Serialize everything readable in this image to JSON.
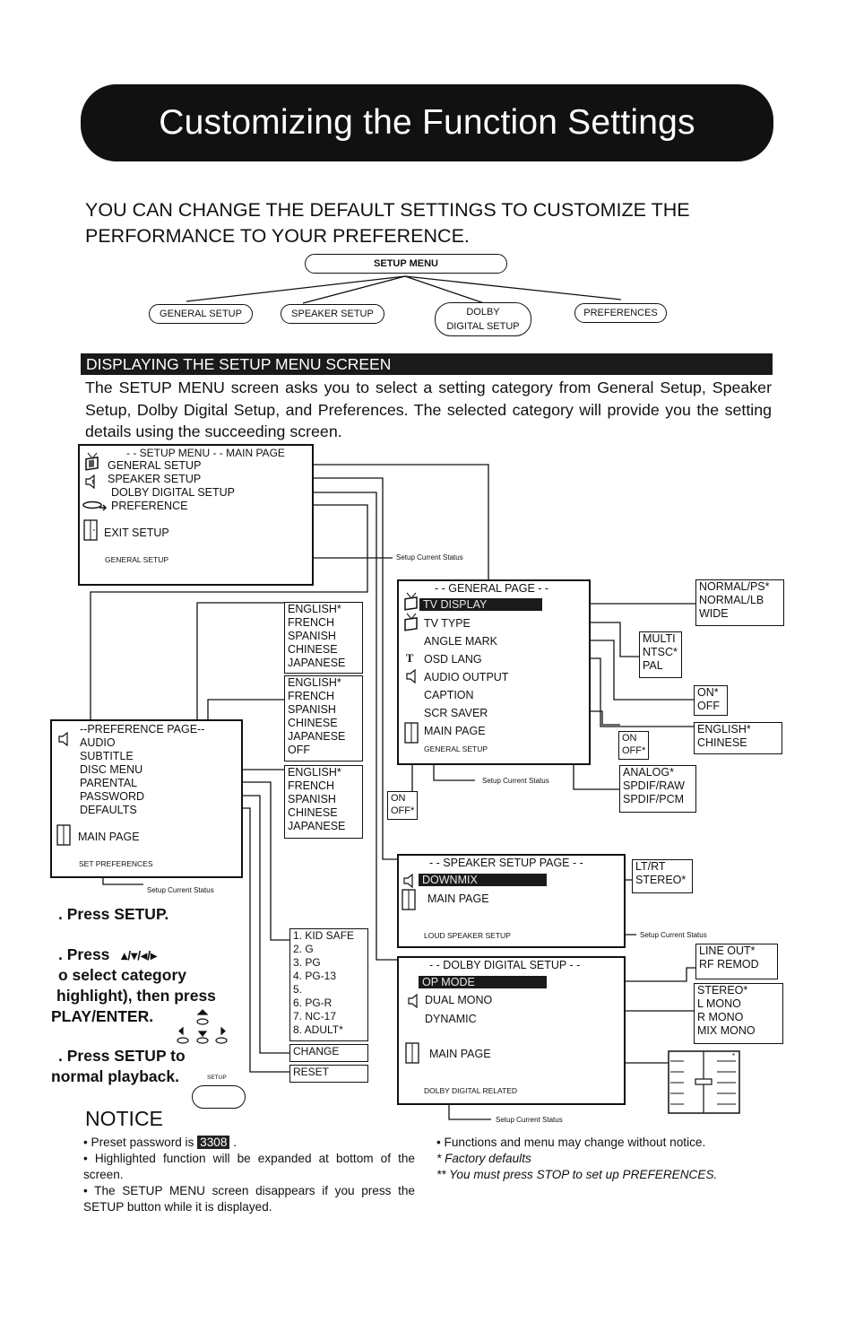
{
  "title": "Customizing the Function Settings",
  "intro": "YOU CAN CHANGE THE DEFAULT SETTINGS TO CUSTOMIZE THE PERFORMANCE TO YOUR PREFERENCE.",
  "tree": {
    "root": "SETUP MENU",
    "children": [
      "GENERAL SETUP",
      "SPEAKER SETUP",
      "DOLBY DIGITAL SETUP",
      "PREFERENCES"
    ],
    "dolby_line1": "DOLBY",
    "dolby_line2": "DIGITAL SETUP"
  },
  "section": {
    "heading": "DISPLAYING THE SETUP MENU SCREEN",
    "paragraph": "The SETUP MENU screen asks you to select a setting category from General Setup, Speaker Setup, Dolby Digital Setup, and Preferences.  The selected category will provide you the setting details using the succeeding screen."
  },
  "main_menu": {
    "title": "- - SETUP MENU - -  MAIN PAGE",
    "items": [
      "GENERAL SETUP",
      "SPEAKER SETUP",
      "DOLBY DIGITAL SETUP",
      "PREFERENCE"
    ],
    "exit": "EXIT SETUP",
    "status": "GENERAL SETUP",
    "status_label": "Setup Current Status"
  },
  "general_page": {
    "title": "- - GENERAL PAGE - -",
    "items": [
      "TV DISPLAY",
      "TV TYPE",
      "ANGLE MARK",
      "OSD LANG",
      "AUDIO OUTPUT",
      "CAPTION",
      "SCR SAVER"
    ],
    "highlighted": "TV DISPLAY",
    "main_page": "MAIN PAGE",
    "status": "GENERAL SETUP",
    "status_label": "Setup Current Status",
    "options": {
      "tv_display": [
        "NORMAL/PS*",
        "NORMAL/LB",
        "WIDE"
      ],
      "tv_type": [
        "MULTI",
        "NTSC*",
        "PAL"
      ],
      "angle_mark": [
        "ON*",
        "OFF"
      ],
      "osd_lang": [
        "ENGLISH*",
        "CHINESE"
      ],
      "scr_saver": [
        "ON",
        "OFF*"
      ],
      "audio_output": [
        "ANALOG*",
        "SPDIF/RAW",
        "SPDIF/PCM"
      ],
      "caption": [
        "ON",
        "OFF*"
      ]
    }
  },
  "preference_page": {
    "title": "--PREFERENCE PAGE--",
    "items": [
      "AUDIO",
      "SUBTITLE",
      "DISC MENU",
      "PARENTAL",
      "PASSWORD",
      "DEFAULTS"
    ],
    "main_page": "MAIN PAGE",
    "status": "SET PREFERENCES",
    "status_label": "Setup Current Status",
    "options": {
      "audio": [
        "ENGLISH*",
        "FRENCH",
        "SPANISH",
        "CHINESE",
        "JAPANESE"
      ],
      "subtitle": [
        "ENGLISH*",
        "FRENCH",
        "SPANISH",
        "CHINESE",
        "JAPANESE",
        "OFF"
      ],
      "disc_menu": [
        "ENGLISH*",
        "FRENCH",
        "SPANISH",
        "CHINESE",
        "JAPANESE"
      ],
      "parental": [
        "1. KID SAFE",
        "2. G",
        "3. PG",
        "4. PG-13",
        "5.",
        "6. PG-R",
        "7. NC-17",
        "8. ADULT*"
      ],
      "password": "CHANGE",
      "defaults": "RESET"
    }
  },
  "speaker_page": {
    "title": "- - SPEAKER SETUP PAGE - -",
    "highlighted": "DOWNMIX",
    "main_page": "MAIN PAGE",
    "status": "LOUD SPEAKER SETUP",
    "status_label": "Setup Current Status",
    "options": {
      "downmix": [
        "LT/RT",
        "STEREO*"
      ]
    }
  },
  "dolby_page": {
    "title": "- - DOLBY DIGITAL SETUP - -",
    "highlighted": "OP MODE",
    "items": [
      "DUAL MONO",
      "DYNAMIC"
    ],
    "main_page": "MAIN PAGE",
    "status": "DOLBY DIGITAL RELATED",
    "status_label": "Setup Current Status",
    "options": {
      "op_mode": [
        "LINE OUT*",
        "RF REMOD"
      ],
      "dual_mono": [
        "STEREO*",
        "L MONO",
        "R MONO",
        "MIX MONO"
      ]
    }
  },
  "steps": {
    "s1": ". Press SETUP.",
    "s2a": ". Press",
    "s2arrows": "▴/▾/◂/▸",
    "s2b": "o select category",
    "s2c": "highlight), then press",
    "s2d": "PLAY/ENTER.",
    "s3a": ". Press SETUP to",
    "s3b": "normal playback.",
    "setup_button_label": "SETUP"
  },
  "notice": {
    "title": "NOTICE",
    "left": {
      "n1_pre": "• Preset password is",
      "password": "3308",
      "n1_post": ".",
      "n2": "• Highlighted function will be expanded at bottom of the screen.",
      "n3": "• The SETUP MENU screen disappears if you press the SETUP button while it is displayed."
    },
    "right": {
      "n1": "• Functions and menu may change without notice.",
      "n2": "* Factory defaults",
      "n3": "** You must press STOP to set up PREFERENCES."
    }
  }
}
